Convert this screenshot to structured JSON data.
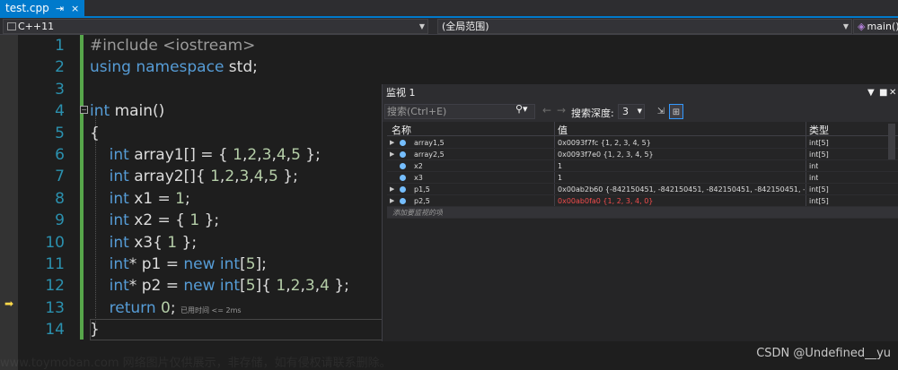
{
  "tab": {
    "filename": "test.cpp",
    "pin_icon": "⇥",
    "close_icon": "×"
  },
  "navbar": {
    "project": "C++11",
    "scope": "(全局范围)",
    "member": "main()"
  },
  "editor": {
    "line_numbers": [
      "1",
      "2",
      "3",
      "4",
      "5",
      "6",
      "7",
      "8",
      "9",
      "10",
      "11",
      "12",
      "13",
      "14"
    ],
    "elapsed_hint": "已用时间 <= 2ms"
  },
  "watch": {
    "title": "监视 1",
    "search_placeholder": "搜索(Ctrl+E)",
    "depth_label": "搜索深度:",
    "depth_value": "3",
    "columns": {
      "name": "名称",
      "value": "值",
      "type": "类型"
    },
    "rows": [
      {
        "name": "array1,5",
        "value": "0x0093f7fc {1, 2, 3, 4, 5}",
        "type": "int[5]",
        "expandable": true,
        "changed": false
      },
      {
        "name": "array2,5",
        "value": "0x0093f7e0 {1, 2, 3, 4, 5}",
        "type": "int[5]",
        "expandable": true,
        "changed": false
      },
      {
        "name": "x2",
        "value": "1",
        "type": "int",
        "expandable": false,
        "changed": false
      },
      {
        "name": "x3",
        "value": "1",
        "type": "int",
        "expandable": false,
        "changed": false
      },
      {
        "name": "p1,5",
        "value": "0x00ab2b60 {-842150451, -842150451, -842150451, -842150451, -842...",
        "type": "int[5]",
        "expandable": true,
        "changed": false
      },
      {
        "name": "p2,5",
        "value": "0x00ab0fa0 {1, 2, 3, 4, 0}",
        "type": "int[5]",
        "expandable": true,
        "changed": true
      }
    ],
    "add_watch": "添加要监视的项"
  },
  "watermark": "www.toymoban.com 网络图片仅供展示，非存储，如有侵权请联系删除。",
  "credit": "CSDN @Undefined__yu",
  "colors": {
    "accent": "#007acc",
    "keyword": "#569cd6",
    "number": "#b5cea8",
    "line_number": "#2b91af",
    "changed_value": "#f14c4c"
  }
}
